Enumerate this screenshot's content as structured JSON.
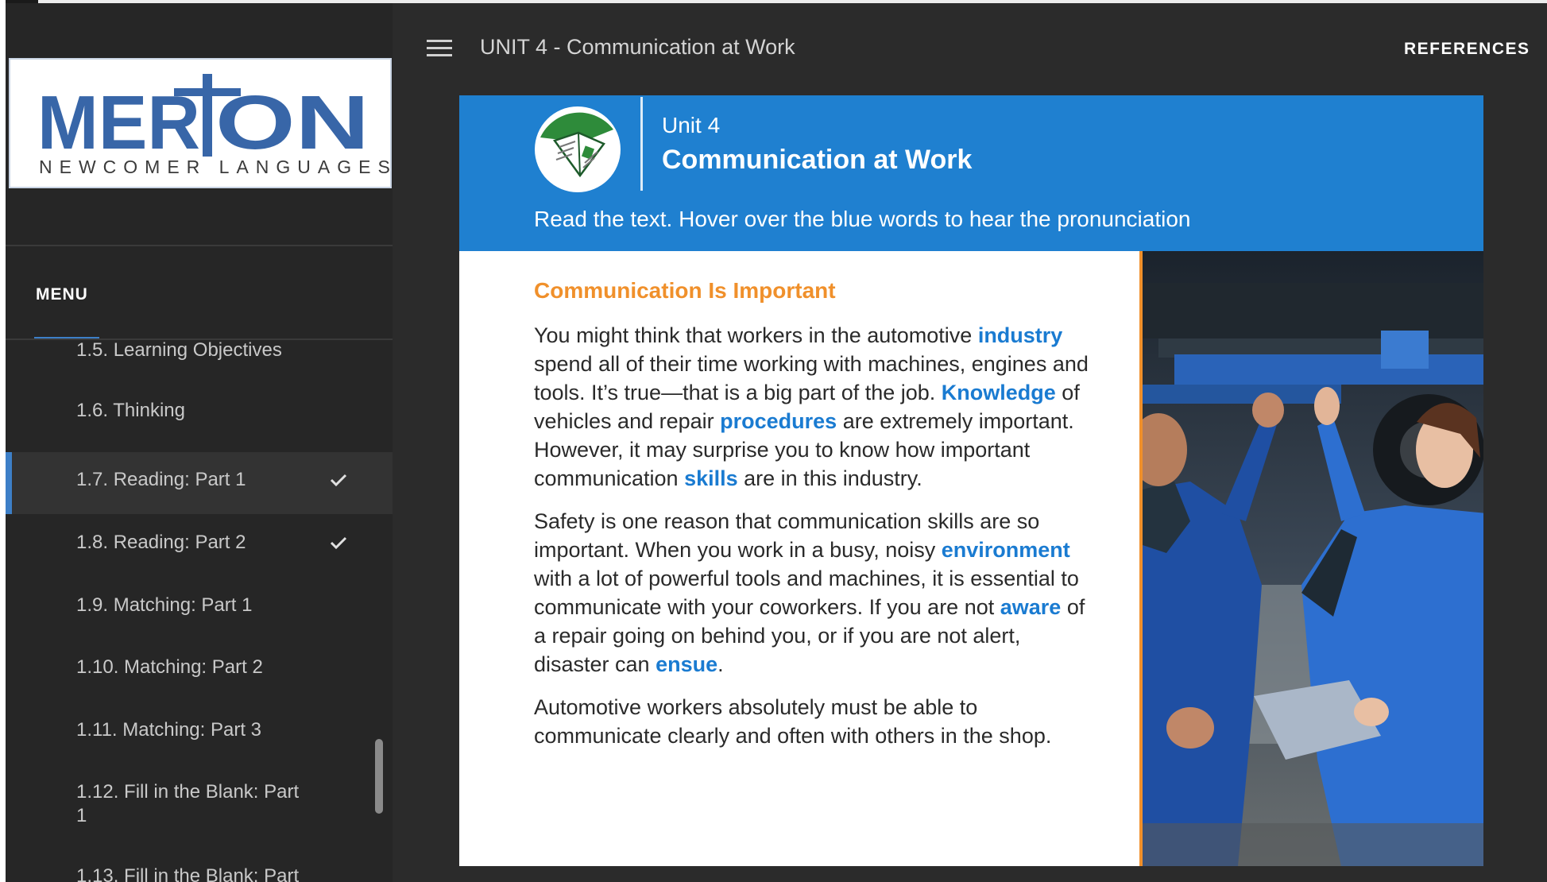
{
  "logo": {
    "main_text": "MERTON",
    "sub_text": "NEWCOMER LANGUAGES"
  },
  "header": {
    "menu_icon": "hamburger-icon",
    "title": "UNIT 4 - Communication at Work",
    "references_label": "REFERENCES"
  },
  "sidebar": {
    "menu_label": "MENU",
    "items": [
      {
        "label": "1.5. Learning Objectives",
        "completed": false
      },
      {
        "label": "1.6. Thinking",
        "completed": false
      },
      {
        "label": "1.7. Reading: Part 1",
        "completed": true,
        "active": true
      },
      {
        "label": "1.8. Reading: Part 2",
        "completed": true
      },
      {
        "label": "1.9. Matching: Part 1",
        "completed": false
      },
      {
        "label": "1.10. Matching: Part 2",
        "completed": false
      },
      {
        "label": "1.11. Matching: Part 3",
        "completed": false
      },
      {
        "label": "1.12. Fill in the Blank: Part 1",
        "completed": false
      },
      {
        "label": "1.13. Fill in the Blank: Part",
        "completed": false
      }
    ]
  },
  "content": {
    "unit_label": "Unit 4",
    "unit_title": "Communication at Work",
    "instruction": "Read the text. Hover over the blue words to hear the pronunciation",
    "section_heading": "Communication Is Important",
    "paragraphs": [
      {
        "t1": "You might think that workers in the automotive ",
        "v1": "industry",
        "t2": " spend all of their time working with machines, engines and tools. It’s true—that is a big part of the job. ",
        "v2": "Knowledge",
        "t3": " of vehicles and repair ",
        "v3": "procedures",
        "t4": " are extremely important. However, it may surprise you to know how important communication ",
        "v4": "skills",
        "t5": " are in this industry."
      },
      {
        "t1": "Safety is one reason that communication skills are so important. When you work in a busy, noisy ",
        "v1": "environment",
        "t2": " with a lot of powerful tools and machines, it is essential to communicate with your coworkers. If you are not ",
        "v2": "aware",
        "t3": " of a repair going on behind you, or if you are not alert, disaster can ",
        "v3": "ensue",
        "t4": "."
      },
      {
        "t1": "Automotive workers absolutely must be able to communicate clearly and often with others in the shop."
      }
    ]
  },
  "colors": {
    "banner_blue": "#1f80d0",
    "vocab_blue": "#1a7bd1",
    "heading_orange": "#f0902b",
    "active_indicator": "#3d7fc7"
  }
}
